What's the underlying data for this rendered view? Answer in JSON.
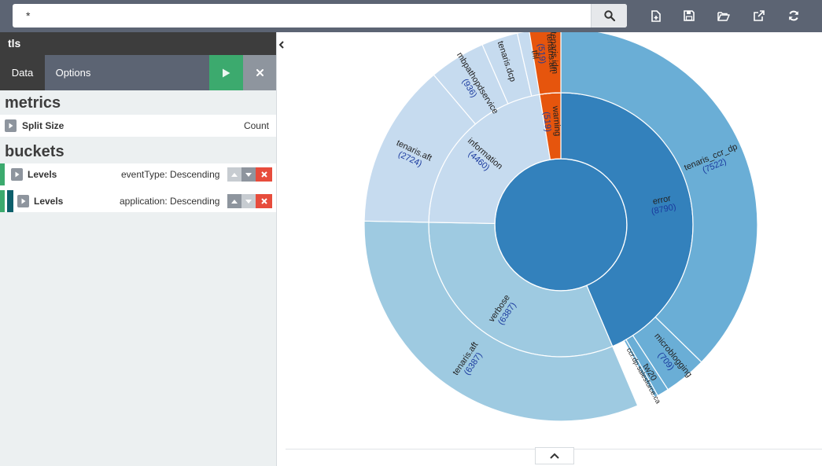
{
  "query": {
    "value": "*"
  },
  "vis_title": "tls",
  "tabs": {
    "data": "Data",
    "options": "Options"
  },
  "metrics": {
    "title": "metrics",
    "items": [
      {
        "name": "Split Size",
        "value": "Count"
      }
    ]
  },
  "buckets": {
    "title": "buckets",
    "items": [
      {
        "name": "Levels",
        "desc": "eventType: Descending"
      },
      {
        "name": "Levels",
        "desc": "application: Descending"
      }
    ]
  },
  "colors": {
    "error_inner": "#3381bc",
    "error_outer": "#6aaed6",
    "verbose": "#9ecae1",
    "information": "#c6dbef",
    "warning": "#e6550d",
    "apply_green": "#3caa6e",
    "remove_red": "#e74c3c"
  },
  "chart_data": {
    "type": "pie",
    "donut": true,
    "levels": [
      {
        "name": "eventType",
        "slices": [
          {
            "label": "error",
            "value": 8790
          },
          {
            "label": "verbose",
            "value": 6387
          },
          {
            "label": "information",
            "value": 4460
          },
          {
            "label": "warning",
            "value": 519
          }
        ]
      },
      {
        "name": "application",
        "slices": [
          {
            "parent": "error",
            "label": "tenaris_ccr_dp",
            "value": 7522
          },
          {
            "parent": "error",
            "label": "microblogging",
            "value": 709
          },
          {
            "parent": "error",
            "label": "tw20",
            "value": ""
          },
          {
            "parent": "error",
            "label": "ccr.dp.salesforce.ca",
            "value": ""
          },
          {
            "parent": "verbose",
            "label": "tenaris.aft",
            "value": 6387
          },
          {
            "parent": "information",
            "label": "tenaris.aft",
            "value": 2724
          },
          {
            "parent": "information",
            "label": "mbpathopdservice",
            "value": 936
          },
          {
            "parent": "information",
            "label": "tenaris.dcp",
            "value": ""
          },
          {
            "parent": "information",
            "label": "tfil",
            "value": ""
          },
          {
            "parent": "information",
            "label": "tenaris.idm",
            "value": ""
          },
          {
            "parent": "warning",
            "label": "tenaris.aft",
            "value": 519
          }
        ]
      }
    ]
  }
}
